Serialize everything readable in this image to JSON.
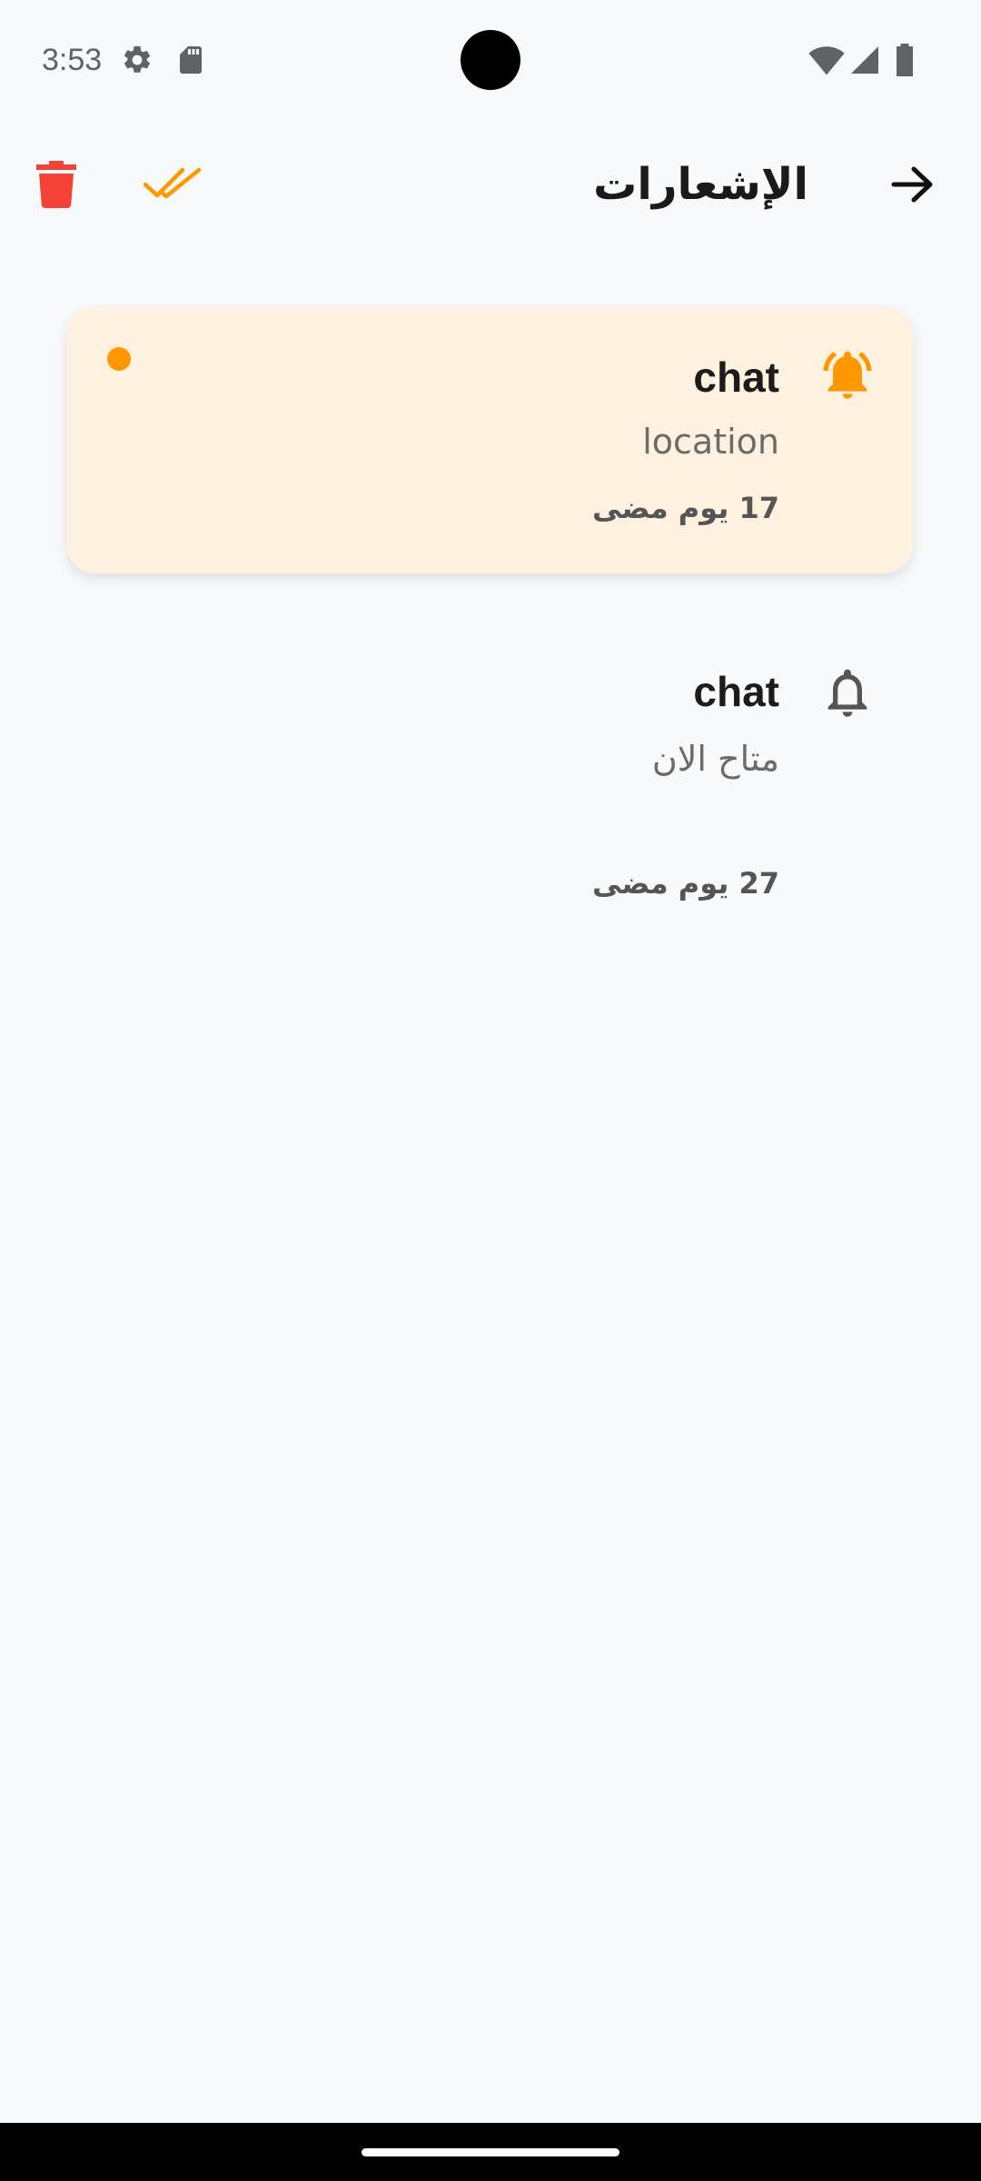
{
  "status_bar": {
    "time": "3:53",
    "icons": [
      "settings-icon",
      "sd-card-icon",
      "wifi-icon",
      "signal-icon",
      "battery-icon"
    ]
  },
  "header": {
    "title": "الإشعارات",
    "back_icon": "arrow-right-icon",
    "mark_all_read_icon": "double-check-icon",
    "delete_all_icon": "trash-icon"
  },
  "notifications": [
    {
      "title": "chat",
      "body": "location",
      "time": "17 يوم مضى",
      "unread": true,
      "icon": "bell-ringing-icon"
    },
    {
      "title": "chat",
      "body": "متاح الان",
      "time": "27 يوم مضى",
      "unread": false,
      "icon": "bell-outline-icon"
    }
  ],
  "colors": {
    "accent": "#ff9800",
    "delete": "#f44336",
    "unread_card_bg": "#fff1e0",
    "page_bg": "#f8f9fa"
  }
}
